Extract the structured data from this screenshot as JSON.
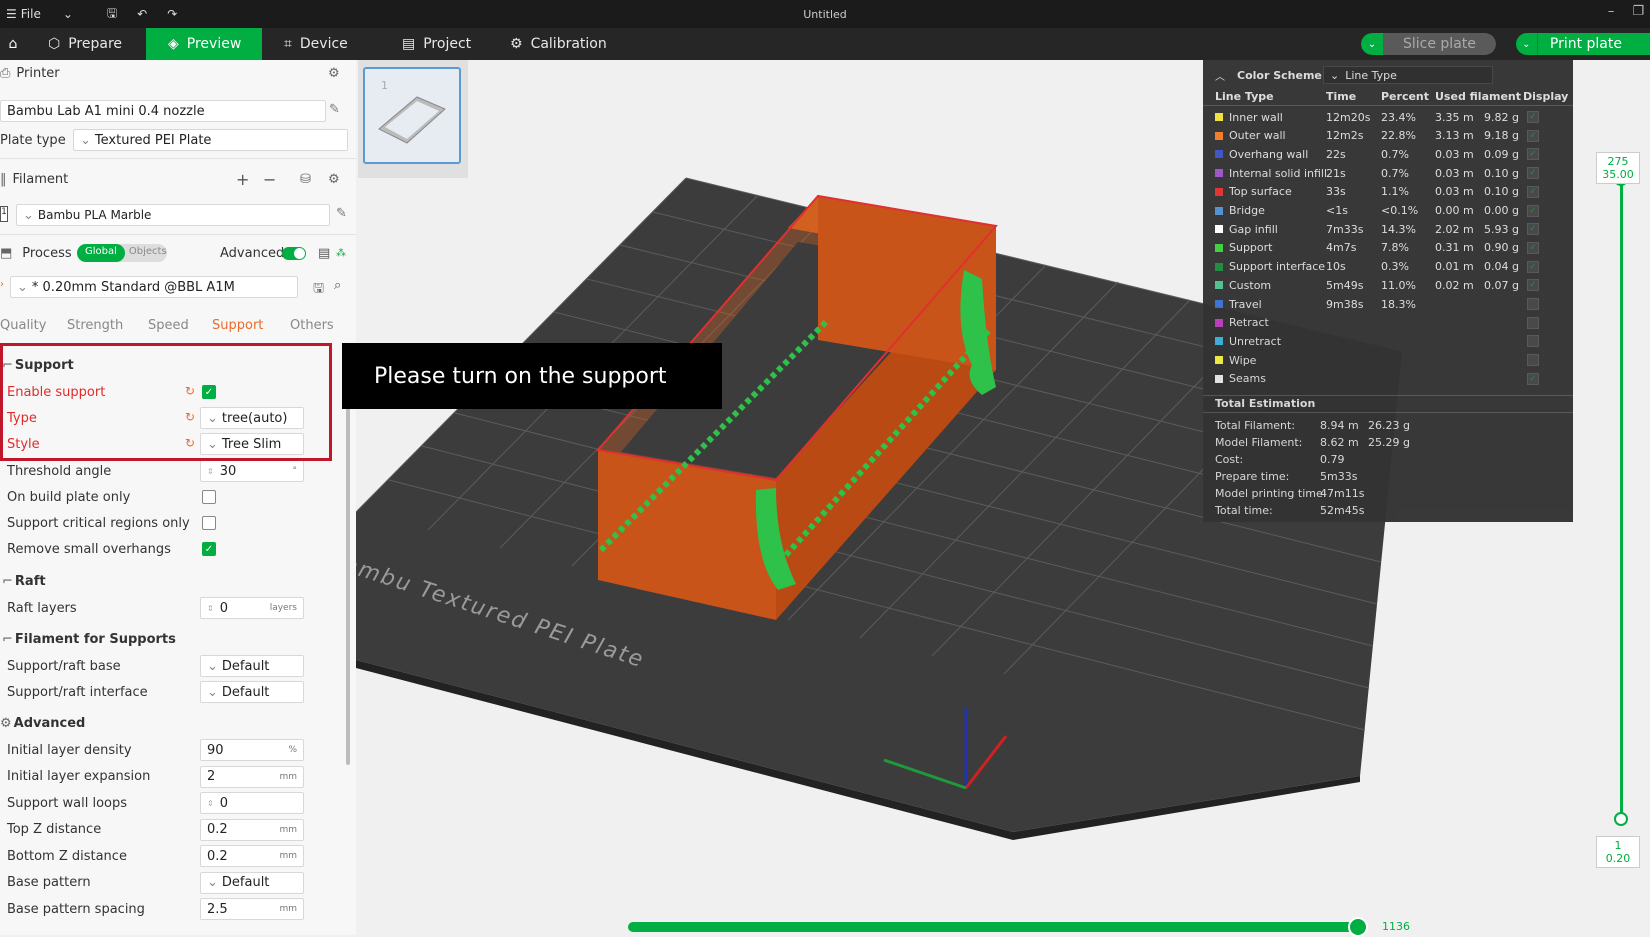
{
  "titlebar": {
    "file_label": "File",
    "window_title": "Untitled"
  },
  "nav": {
    "tabs": [
      {
        "label": "Prepare",
        "icon": "cube-icon"
      },
      {
        "label": "Preview",
        "icon": "layers-icon"
      },
      {
        "label": "Device",
        "icon": "device-icon"
      },
      {
        "label": "Project",
        "icon": "project-icon"
      },
      {
        "label": "Calibration",
        "icon": "calibration-icon"
      }
    ],
    "slice_label": "Slice plate",
    "print_label": "Print plate"
  },
  "sidebar": {
    "printer_header": "Printer",
    "printer_value": "Bambu Lab A1 mini 0.4 nozzle",
    "plate_type_label": "Plate type",
    "plate_type_value": "Textured PEI Plate",
    "filament_header": "Filament",
    "filament_index": "1",
    "filament_value": "Bambu PLA Marble",
    "process_header": "Process",
    "toggle_global": "Global",
    "toggle_objects": "Objects",
    "advanced_label": "Advanced",
    "preset_value": "* 0.20mm Standard @BBL A1M",
    "subtabs": [
      "Quality",
      "Strength",
      "Speed",
      "Support",
      "Others"
    ],
    "support_section": "Support",
    "enable_support": "Enable support",
    "type_label": "Type",
    "type_value": "tree(auto)",
    "style_label": "Style",
    "style_value": "Tree Slim",
    "threshold_label": "Threshold angle",
    "threshold_value": "30",
    "threshold_unit": "°",
    "build_plate_only": "On build plate only",
    "critical_only": "Support critical regions only",
    "remove_small": "Remove small overhangs",
    "raft_section": "Raft",
    "raft_layers_label": "Raft layers",
    "raft_layers_value": "0",
    "raft_layers_unit": "layers",
    "filament_supports_section": "Filament for Supports",
    "raft_base_label": "Support/raft base",
    "raft_base_value": "Default",
    "raft_interface_label": "Support/raft interface",
    "raft_interface_value": "Default",
    "advanced_section": "Advanced",
    "adv_rows": [
      {
        "label": "Initial layer density",
        "value": "90",
        "unit": "%"
      },
      {
        "label": "Initial layer expansion",
        "value": "2",
        "unit": "mm"
      },
      {
        "label": "Support wall loops",
        "value": "0",
        "unit": ""
      },
      {
        "label": "Top Z distance",
        "value": "0.2",
        "unit": "mm"
      },
      {
        "label": "Bottom Z distance",
        "value": "0.2",
        "unit": "mm"
      },
      {
        "label": "Base pattern",
        "value": "Default",
        "unit": ""
      },
      {
        "label": "Base pattern spacing",
        "value": "2.5",
        "unit": "mm"
      }
    ]
  },
  "thumbnail_index": "1",
  "callout": "Please turn on the support",
  "legend": {
    "color_scheme_label": "Color Scheme",
    "color_scheme_value": "Line Type",
    "headers": [
      "Line Type",
      "Time",
      "Percent",
      "Used filament",
      "Display"
    ],
    "rows": [
      {
        "name": "Inner wall",
        "color": "#f0e23a",
        "time": "12m20s",
        "percent": "23.4%",
        "len": "3.35 m",
        "wt": "9.82 g",
        "display": true
      },
      {
        "name": "Outer wall",
        "color": "#f07b24",
        "time": "12m2s",
        "percent": "22.8%",
        "len": "3.13 m",
        "wt": "9.18 g",
        "display": true
      },
      {
        "name": "Overhang wall",
        "color": "#3b54c4",
        "time": "22s",
        "percent": "0.7%",
        "len": "0.03 m",
        "wt": "0.09 g",
        "display": true
      },
      {
        "name": "Internal solid infill",
        "color": "#a050c8",
        "time": "21s",
        "percent": "0.7%",
        "len": "0.03 m",
        "wt": "0.10 g",
        "display": true
      },
      {
        "name": "Top surface",
        "color": "#e03030",
        "time": "33s",
        "percent": "1.1%",
        "len": "0.03 m",
        "wt": "0.10 g",
        "display": true
      },
      {
        "name": "Bridge",
        "color": "#4f8fd0",
        "time": "<1s",
        "percent": "<0.1%",
        "len": "0.00 m",
        "wt": "0.00 g",
        "display": true
      },
      {
        "name": "Gap infill",
        "color": "#ffffff",
        "time": "7m33s",
        "percent": "14.3%",
        "len": "2.02 m",
        "wt": "5.93 g",
        "display": true
      },
      {
        "name": "Support",
        "color": "#3ccf3c",
        "time": "4m7s",
        "percent": "7.8%",
        "len": "0.31 m",
        "wt": "0.90 g",
        "display": true
      },
      {
        "name": "Support interface",
        "color": "#1e8a3c",
        "time": "10s",
        "percent": "0.3%",
        "len": "0.01 m",
        "wt": "0.04 g",
        "display": true
      },
      {
        "name": "Custom",
        "color": "#4fbf8f",
        "time": "5m49s",
        "percent": "11.0%",
        "len": "0.02 m",
        "wt": "0.07 g",
        "display": true
      },
      {
        "name": "Travel",
        "color": "#3c6fd0",
        "time": "9m38s",
        "percent": "18.3%",
        "len": "",
        "wt": "",
        "display": false
      },
      {
        "name": "Retract",
        "color": "#c040c0",
        "time": "",
        "percent": "",
        "len": "",
        "wt": "",
        "display": false
      },
      {
        "name": "Unretract",
        "color": "#40b0e0",
        "time": "",
        "percent": "",
        "len": "",
        "wt": "",
        "display": false
      },
      {
        "name": "Wipe",
        "color": "#f0f040",
        "time": "",
        "percent": "",
        "len": "",
        "wt": "",
        "display": false
      },
      {
        "name": "Seams",
        "color": "#e8e8e8",
        "time": "",
        "percent": "",
        "len": "",
        "wt": "",
        "display": true
      }
    ],
    "total_header": "Total Estimation",
    "totals": [
      {
        "label": "Total Filament:",
        "v1": "8.94 m",
        "v2": "26.23 g"
      },
      {
        "label": "Model Filament:",
        "v1": "8.62 m",
        "v2": "25.29 g"
      },
      {
        "label": "Cost:",
        "v1": "0.79",
        "v2": ""
      },
      {
        "label": "Prepare time:",
        "v1": "5m33s",
        "v2": ""
      },
      {
        "label": "Model printing time:",
        "v1": "47m11s",
        "v2": ""
      },
      {
        "label": "Total time:",
        "v1": "52m45s",
        "v2": ""
      }
    ]
  },
  "plate_text": "Bambu Textured PEI Plate",
  "layer_slider": {
    "top_layer": "275",
    "top_height": "35.00",
    "bottom_layer": "1",
    "bottom_height": "0.20"
  },
  "move_slider": {
    "value": "1136"
  }
}
